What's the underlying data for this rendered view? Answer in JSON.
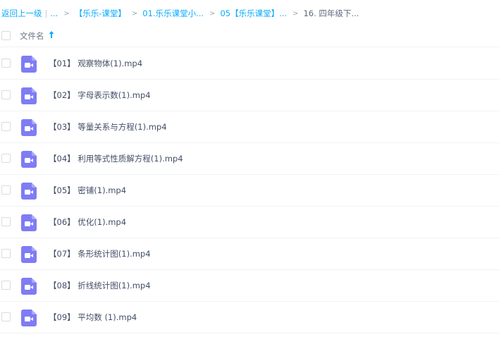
{
  "breadcrumb": {
    "back": "返回上一级",
    "ellipsis": "...",
    "crumbs": [
      "【乐乐-课堂】",
      "01.乐乐课堂小...",
      "05【乐乐课堂】..."
    ],
    "current": "16. 四年级下...",
    "separator": ">"
  },
  "header": {
    "name_column": "文件名",
    "sort_icon": "arrow-up-icon"
  },
  "files": [
    {
      "name": "【01】 观察物体(1).mp4",
      "icon": "video-file-icon"
    },
    {
      "name": "【02】 字母表示数(1).mp4",
      "icon": "video-file-icon"
    },
    {
      "name": "【03】 等量关系与方程(1).mp4",
      "icon": "video-file-icon"
    },
    {
      "name": "【04】 利用等式性质解方程(1).mp4",
      "icon": "video-file-icon"
    },
    {
      "name": "【05】 密铺(1).mp4",
      "icon": "video-file-icon"
    },
    {
      "name": "【06】 优化(1).mp4",
      "icon": "video-file-icon"
    },
    {
      "name": "【07】 条形统计图(1).mp4",
      "icon": "video-file-icon"
    },
    {
      "name": "【08】 折线统计图(1).mp4",
      "icon": "video-file-icon"
    },
    {
      "name": "【09】 平均数 (1).mp4",
      "icon": "video-file-icon"
    }
  ],
  "colors": {
    "accent": "#09aaff",
    "video_icon": "#7f7cf4",
    "text": "#424e67"
  }
}
